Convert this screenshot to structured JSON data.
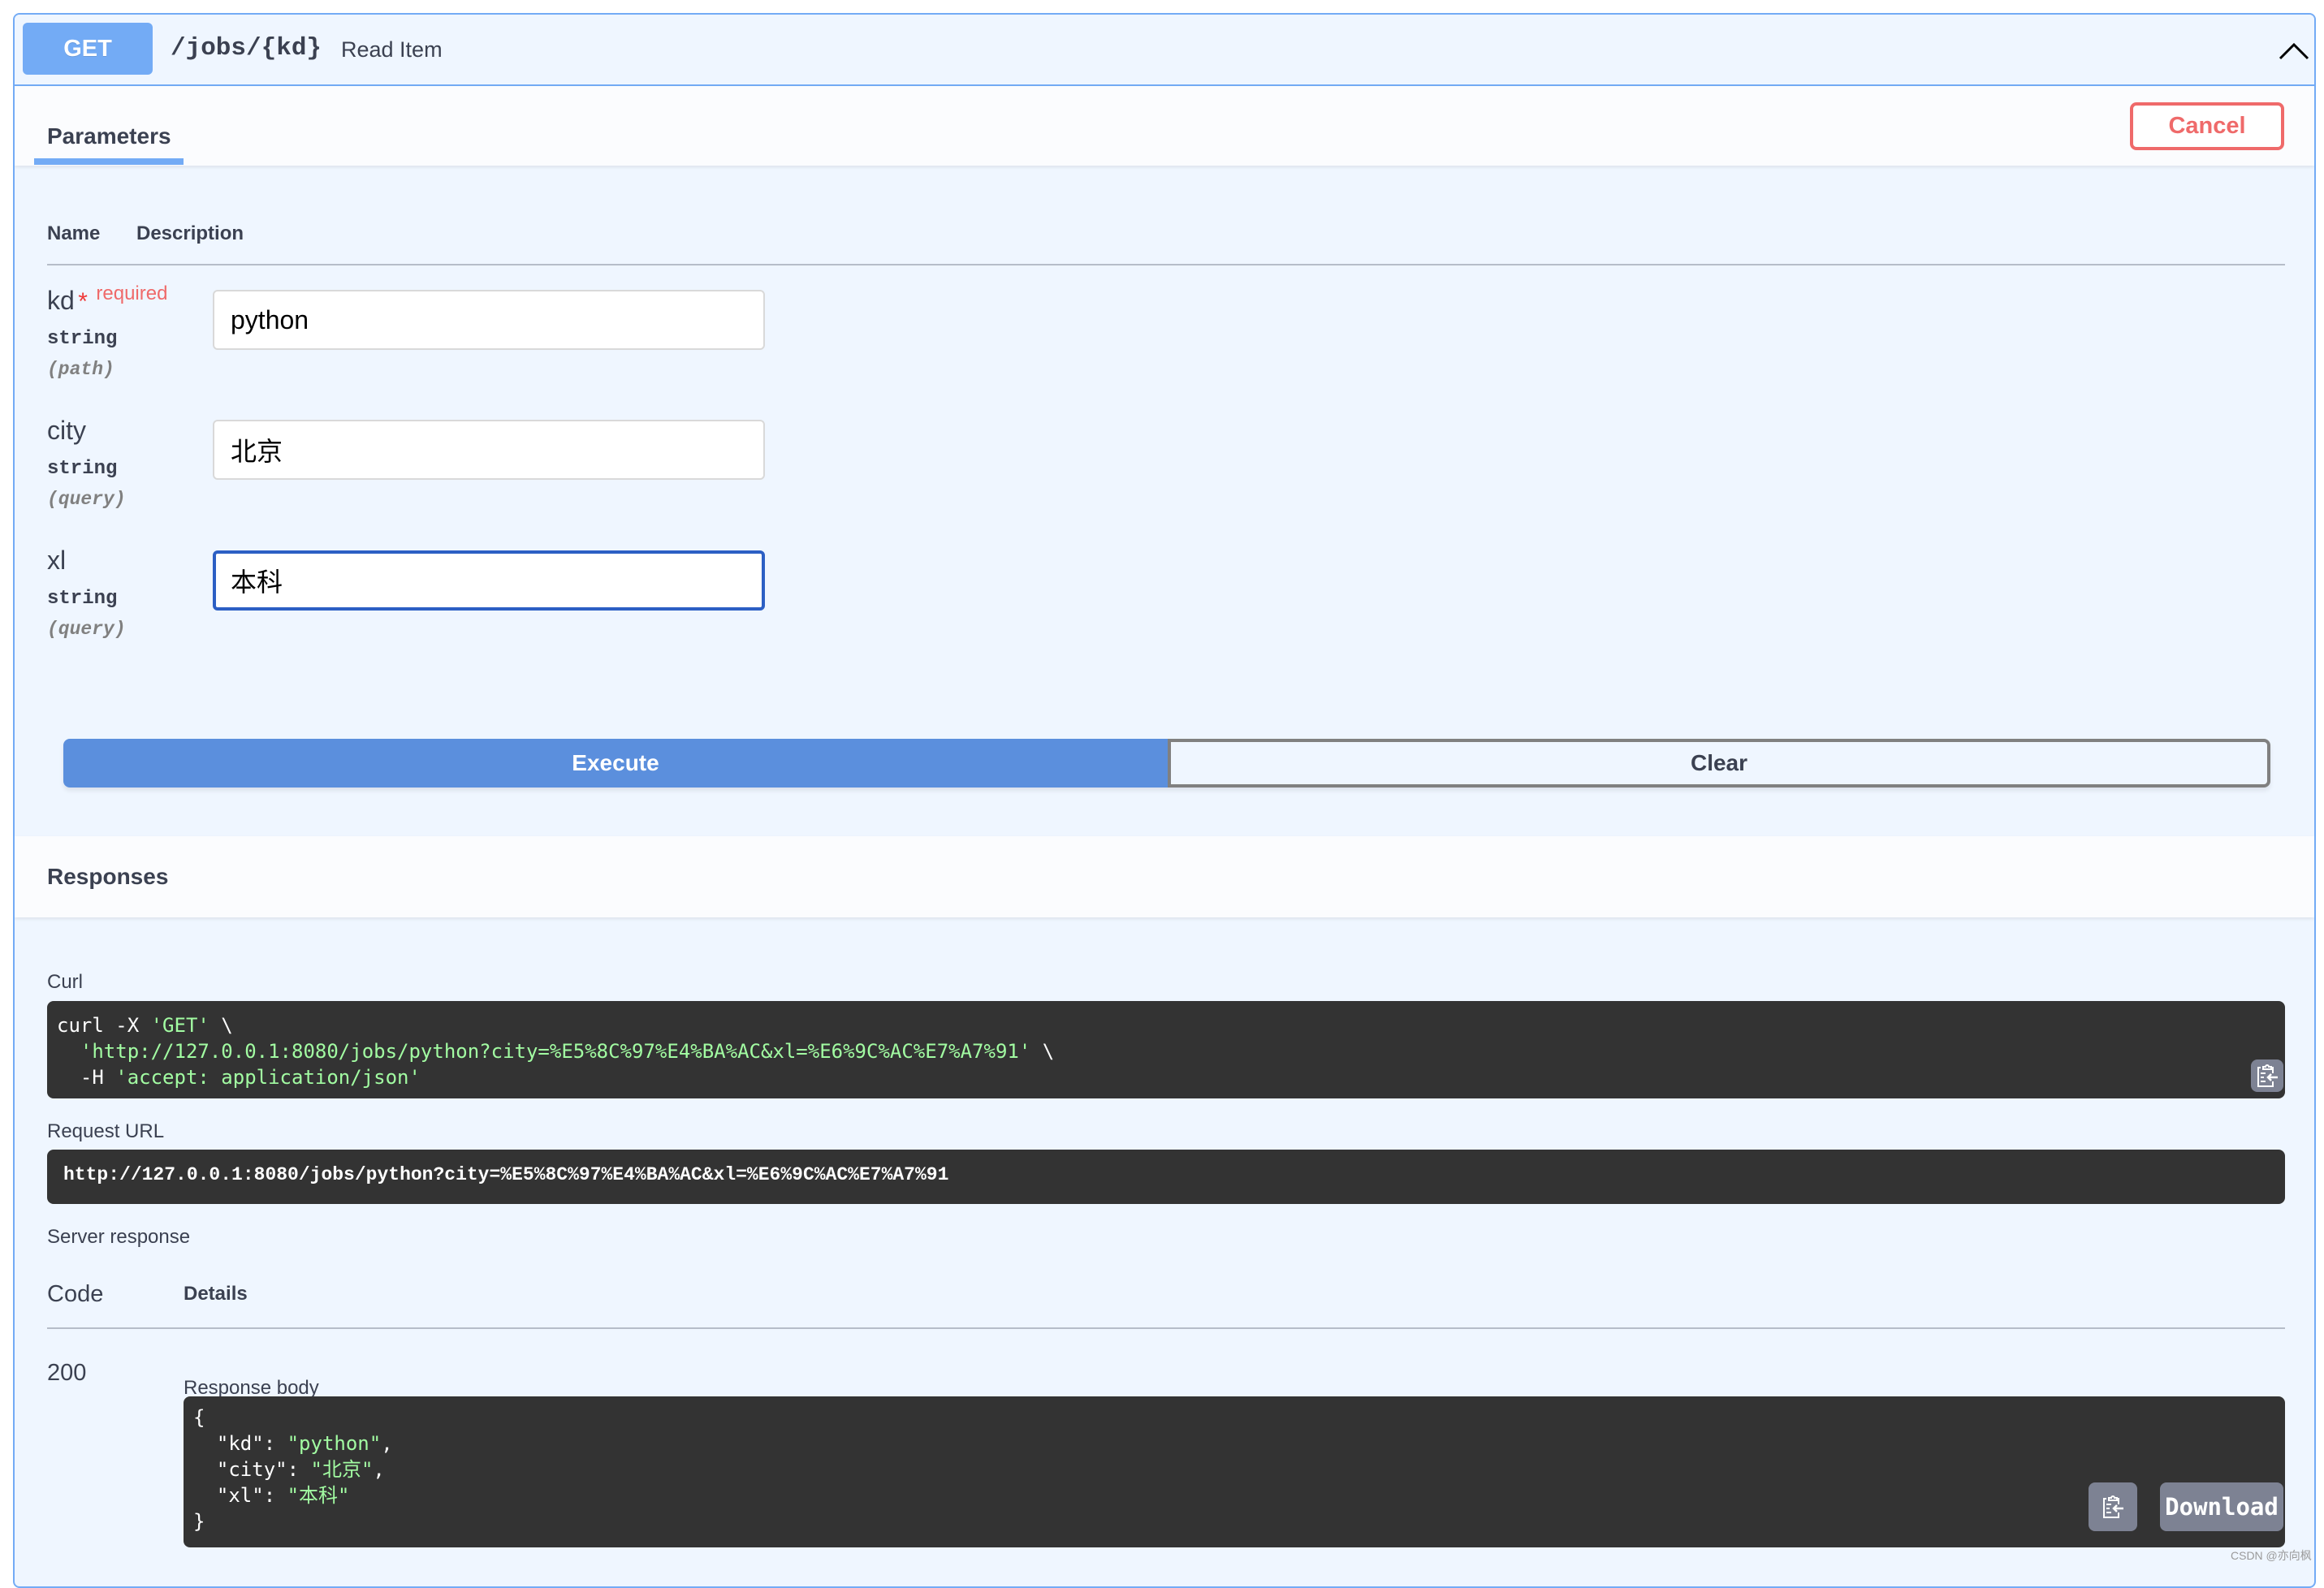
{
  "operation": {
    "method": "GET",
    "path": "/jobs/{kd}",
    "summary": "Read Item",
    "collapse_icon": "chevron-up-icon"
  },
  "tabs": {
    "parameters_label": "Parameters",
    "cancel_label": "Cancel"
  },
  "parameters": {
    "headers": {
      "name": "Name",
      "description": "Description"
    },
    "items": [
      {
        "name": "kd",
        "required_mark": "*",
        "required_text": "required",
        "type": "string",
        "in": "(path)",
        "value": "python"
      },
      {
        "name": "city",
        "type": "string",
        "in": "(query)",
        "value": "北京"
      },
      {
        "name": "xl",
        "type": "string",
        "in": "(query)",
        "value": "本科"
      }
    ]
  },
  "actions": {
    "execute_label": "Execute",
    "clear_label": "Clear"
  },
  "responses": {
    "title": "Responses",
    "curl_label": "Curl",
    "curl": {
      "line1_cmd": "curl -X ",
      "line1_str": "'GET'",
      "line1_end": " \\",
      "line2_indent": "  ",
      "line2_str": "'http://127.0.0.1:8080/jobs/python?city=%E5%8C%97%E4%BA%AC&xl=%E6%9C%AC%E7%A7%91'",
      "line2_end": " \\",
      "line3_cmd": "  -H ",
      "line3_str": "'accept: application/json'"
    },
    "request_url_label": "Request URL",
    "request_url": "http://127.0.0.1:8080/jobs/python?city=%E5%8C%97%E4%BA%AC&xl=%E6%9C%AC%E7%A7%91",
    "server_response_label": "Server response",
    "table_headers": {
      "code": "Code",
      "details": "Details"
    },
    "code": "200",
    "response_body_label": "Response body",
    "body": {
      "open": "{",
      "kd_key": "  \"kd\": ",
      "kd_val": "\"python\"",
      "city_key": "  \"city\": ",
      "city_val": "\"北京\"",
      "xl_key": "  \"xl\": ",
      "xl_val": "\"本科\"",
      "close": "}"
    },
    "copy_icon": "clipboard-copy-icon",
    "download_label": "Download"
  },
  "watermark": "CSDN @亦向枫"
}
